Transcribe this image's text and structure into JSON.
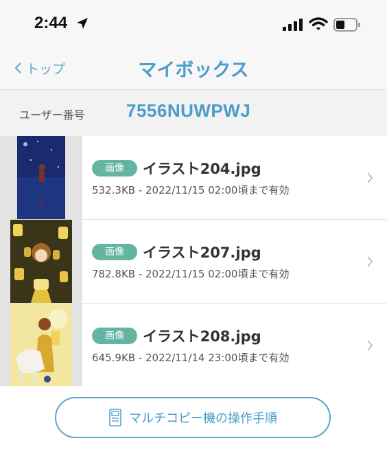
{
  "status_bar": {
    "time": "2:44",
    "icons": [
      "location-arrow-icon",
      "signal-icon",
      "wifi-icon",
      "battery-icon"
    ]
  },
  "nav": {
    "back_label": "トップ",
    "title": "マイボックス"
  },
  "user": {
    "label": "ユーザー番号",
    "number": "7556NUWPWJ"
  },
  "files": [
    {
      "badge": "画像",
      "name": "イラスト204.jpg",
      "meta": "532.3KB - 2022/11/15 02:00頃まで有効"
    },
    {
      "badge": "画像",
      "name": "イラスト207.jpg",
      "meta": "782.8KB - 2022/11/15 02:00頃まで有効"
    },
    {
      "badge": "画像",
      "name": "イラスト208.jpg",
      "meta": "645.9KB - 2022/11/14 23:00頃まで有効"
    }
  ],
  "footer": {
    "manual_button": "マルチコピー機の操作手順"
  },
  "colors": {
    "accent": "#4a9ccb",
    "badge": "#63b4a1"
  }
}
